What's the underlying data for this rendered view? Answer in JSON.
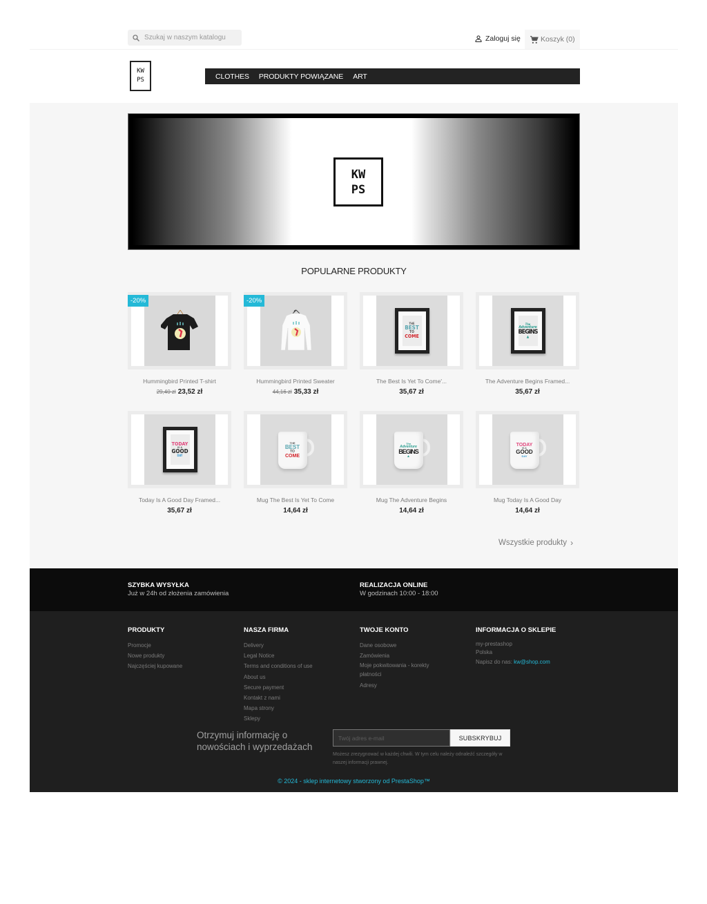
{
  "header": {
    "search_placeholder": "Szukaj w naszym katalogu",
    "login_label": "Zaloguj się",
    "cart_label": "Koszyk (0)",
    "logo_line1": "KW",
    "logo_line2": "PS",
    "nav": [
      "CLOTHES",
      "PRODUKTY POWIĄZANE",
      "ART"
    ]
  },
  "banner": {
    "logo_line1": "KW",
    "logo_line2": "PS"
  },
  "popular": {
    "title": "POPULARNE PRODUKTY",
    "products": [
      {
        "name": "Hummingbird Printed T-shirt",
        "old_price": "29,40 zł",
        "price": "23,52 zł",
        "badge": "-20%",
        "image": "black-tshirt"
      },
      {
        "name": "Hummingbird Printed Sweater",
        "old_price": "44,16 zł",
        "price": "35,33 zł",
        "badge": "-20%",
        "image": "white-sweater"
      },
      {
        "name": "The Best Is Yet To Come'...",
        "price": "35,67 zł",
        "image": "framed-best-poster"
      },
      {
        "name": "The Adventure Begins Framed...",
        "price": "35,67 zł",
        "image": "framed-adventure-poster"
      },
      {
        "name": "Today Is A Good Day Framed...",
        "price": "35,67 zł",
        "image": "framed-goodday-poster"
      },
      {
        "name": "Mug The Best Is Yet To Come",
        "price": "14,64 zł",
        "image": "mug-best"
      },
      {
        "name": "Mug The Adventure Begins",
        "price": "14,64 zł",
        "image": "mug-adventure"
      },
      {
        "name": "Mug Today Is A Good Day",
        "price": "14,64 zł",
        "image": "mug-goodday"
      }
    ],
    "all_products_label": "Wszystkie produkty"
  },
  "art_text": {
    "best": [
      "THE",
      "BEST",
      "IS YET",
      "TO",
      "COME"
    ],
    "adventure": [
      "The",
      "Adventure",
      "BEGINS"
    ],
    "goodday": [
      "TODAY",
      "IS A",
      "GOOD",
      "DAY"
    ]
  },
  "reassurance": [
    {
      "title": "SZYBKA WYSYŁKA",
      "subtitle": "Już w 24h od złożenia zamówienia"
    },
    {
      "title": "REALIZACJA ONLINE",
      "subtitle": "W godzinach 10:00 - 18:00"
    }
  ],
  "footer": {
    "columns": [
      {
        "title": "PRODUKTY",
        "links": [
          "Promocje",
          "Nowe produkty",
          "Najczęściej kupowane"
        ]
      },
      {
        "title": "NASZA FIRMA",
        "links": [
          "Delivery",
          "Legal Notice",
          "Terms and conditions of use",
          "About us",
          "Secure payment",
          "Kontakt z nami",
          "Mapa strony",
          "Sklepy"
        ]
      },
      {
        "title": "TWOJE KONTO",
        "links": [
          "Dane osobowe",
          "Zamówienia",
          "Moje pokwitowania - korekty płatności",
          "Adresy"
        ]
      },
      {
        "title": "INFORMACJA O SKLEPIE",
        "lines": [
          "my-prestashop",
          "Polska"
        ],
        "email_prefix": "Napisz do nas:",
        "email": "kw@shop.com"
      }
    ],
    "newsletter": {
      "title": "Otrzymuj informację o nowościach i wyprzedażach",
      "placeholder": "Twój adres e-mail",
      "button": "SUBSKRYBUJ",
      "note": "Możesz zrezygnować w każdej chwili. W tym celu należy odnaleźć szczegóły w naszej informacji prawnej."
    },
    "copyright": "© 2024 - sklep internetowy stworzony od PrestaShop™"
  },
  "colors": {
    "accent": "#24b9d7",
    "nav_bg": "#232323",
    "footer_bg": "#1f1f1f",
    "reassurance_bg": "#0c0c0c",
    "page_bg": "#f6f6f6"
  }
}
